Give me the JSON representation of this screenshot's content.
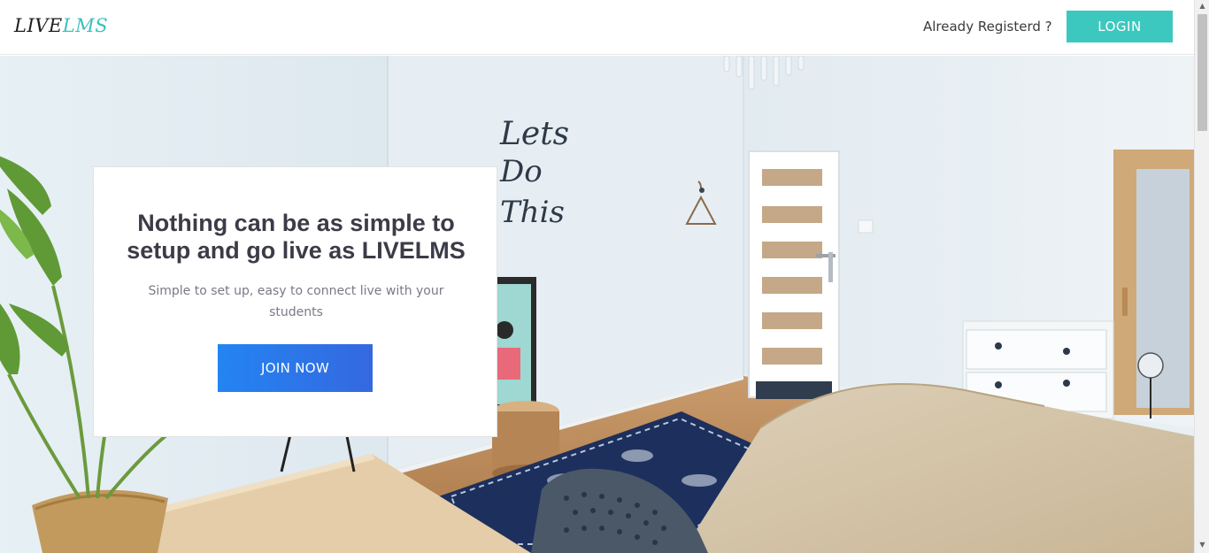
{
  "header": {
    "logo": {
      "part1": "LIVE",
      "part2": "LMS"
    },
    "already_registered": "Already Registerd ?",
    "login_label": "LOGIN"
  },
  "hero": {
    "title": "Nothing can be as simple to setup and go live as LIVELMS",
    "subtitle": "Simple to set up, easy to connect live with your students",
    "cta_label": "JOIN NOW",
    "wall_lettering": [
      "Lets",
      "Do",
      "This"
    ]
  },
  "colors": {
    "accent_teal": "#3cc8bf",
    "cta_blue_start": "#2384f2",
    "cta_blue_end": "#3568e0"
  },
  "icons": [
    "scroll-up-arrow-icon",
    "scroll-down-arrow-icon"
  ]
}
